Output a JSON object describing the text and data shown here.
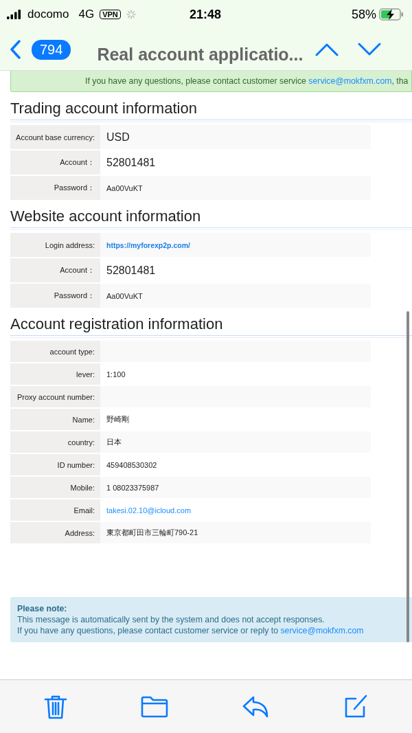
{
  "status_bar": {
    "carrier": "docomo",
    "network": "4G",
    "vpn": "VPN",
    "time": "21:48",
    "battery": "58%"
  },
  "nav": {
    "unread_count": "794",
    "title": "Real account applicatio..."
  },
  "top_notice": {
    "text": "If you have any questions, please contact customer service ",
    "link": "service@mokfxm.com",
    "tail": ", tha"
  },
  "sections": [
    {
      "title": "Trading account information",
      "rows": [
        {
          "label": "Account base currency:",
          "value": "USD",
          "kind": "large"
        },
        {
          "label": "Account：",
          "value": "52801481",
          "kind": "large"
        },
        {
          "label": "Password：",
          "value": "Aa00VuKT",
          "kind": "plain"
        }
      ]
    },
    {
      "title": "Website account information",
      "rows": [
        {
          "label": "Login address:",
          "value": "https://myforexp2p.com/",
          "kind": "link"
        },
        {
          "label": "Account：",
          "value": "52801481",
          "kind": "large"
        },
        {
          "label": "Password：",
          "value": "Aa00VuKT",
          "kind": "plain"
        }
      ]
    },
    {
      "title": "Account registration information",
      "rows": [
        {
          "label": "account type:",
          "value": null
        },
        {
          "label": "lever:",
          "value": "1:100",
          "kind": "plain"
        },
        {
          "label": "Proxy account number:",
          "value": null
        },
        {
          "label": "Name:",
          "value": "野崎剛",
          "kind": "plain"
        },
        {
          "label": "country:",
          "value": "日本",
          "kind": "plain"
        },
        {
          "label": "ID number:",
          "value": "459408530302",
          "kind": "plain"
        },
        {
          "label": "Mobile:",
          "value": "1 08023375987",
          "kind": "plain"
        },
        {
          "label": "Email:",
          "value": "takesi.02.10@icloud.com",
          "kind": "email"
        },
        {
          "label": "Address:",
          "value": "東京都町田市三輪町790-21",
          "kind": "plain"
        }
      ]
    }
  ],
  "note": {
    "title": "Please note:",
    "line_1": "This message is automatically sent by the system and does not accept responses.",
    "line_2": "If you have any questions, please contact customer service or reply to ",
    "link": "service@mokfxm.com"
  }
}
